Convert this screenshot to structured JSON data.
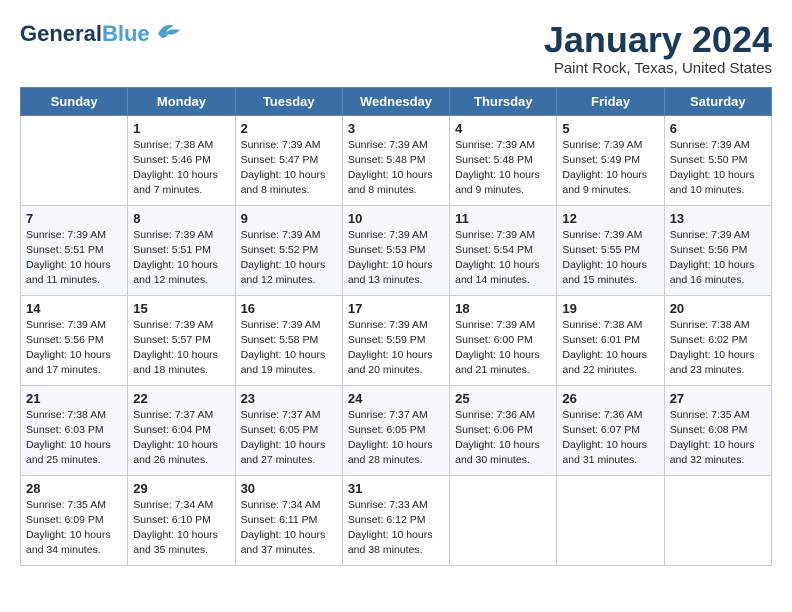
{
  "header": {
    "logo_general": "General",
    "logo_blue": "Blue",
    "title": "January 2024",
    "location": "Paint Rock, Texas, United States"
  },
  "days_of_week": [
    "Sunday",
    "Monday",
    "Tuesday",
    "Wednesday",
    "Thursday",
    "Friday",
    "Saturday"
  ],
  "weeks": [
    [
      {
        "day": "",
        "details": ""
      },
      {
        "day": "1",
        "details": "Sunrise: 7:38 AM\nSunset: 5:46 PM\nDaylight: 10 hours\nand 7 minutes."
      },
      {
        "day": "2",
        "details": "Sunrise: 7:39 AM\nSunset: 5:47 PM\nDaylight: 10 hours\nand 8 minutes."
      },
      {
        "day": "3",
        "details": "Sunrise: 7:39 AM\nSunset: 5:48 PM\nDaylight: 10 hours\nand 8 minutes."
      },
      {
        "day": "4",
        "details": "Sunrise: 7:39 AM\nSunset: 5:48 PM\nDaylight: 10 hours\nand 9 minutes."
      },
      {
        "day": "5",
        "details": "Sunrise: 7:39 AM\nSunset: 5:49 PM\nDaylight: 10 hours\nand 9 minutes."
      },
      {
        "day": "6",
        "details": "Sunrise: 7:39 AM\nSunset: 5:50 PM\nDaylight: 10 hours\nand 10 minutes."
      }
    ],
    [
      {
        "day": "7",
        "details": "Sunrise: 7:39 AM\nSunset: 5:51 PM\nDaylight: 10 hours\nand 11 minutes."
      },
      {
        "day": "8",
        "details": "Sunrise: 7:39 AM\nSunset: 5:51 PM\nDaylight: 10 hours\nand 12 minutes."
      },
      {
        "day": "9",
        "details": "Sunrise: 7:39 AM\nSunset: 5:52 PM\nDaylight: 10 hours\nand 12 minutes."
      },
      {
        "day": "10",
        "details": "Sunrise: 7:39 AM\nSunset: 5:53 PM\nDaylight: 10 hours\nand 13 minutes."
      },
      {
        "day": "11",
        "details": "Sunrise: 7:39 AM\nSunset: 5:54 PM\nDaylight: 10 hours\nand 14 minutes."
      },
      {
        "day": "12",
        "details": "Sunrise: 7:39 AM\nSunset: 5:55 PM\nDaylight: 10 hours\nand 15 minutes."
      },
      {
        "day": "13",
        "details": "Sunrise: 7:39 AM\nSunset: 5:56 PM\nDaylight: 10 hours\nand 16 minutes."
      }
    ],
    [
      {
        "day": "14",
        "details": "Sunrise: 7:39 AM\nSunset: 5:56 PM\nDaylight: 10 hours\nand 17 minutes."
      },
      {
        "day": "15",
        "details": "Sunrise: 7:39 AM\nSunset: 5:57 PM\nDaylight: 10 hours\nand 18 minutes."
      },
      {
        "day": "16",
        "details": "Sunrise: 7:39 AM\nSunset: 5:58 PM\nDaylight: 10 hours\nand 19 minutes."
      },
      {
        "day": "17",
        "details": "Sunrise: 7:39 AM\nSunset: 5:59 PM\nDaylight: 10 hours\nand 20 minutes."
      },
      {
        "day": "18",
        "details": "Sunrise: 7:39 AM\nSunset: 6:00 PM\nDaylight: 10 hours\nand 21 minutes."
      },
      {
        "day": "19",
        "details": "Sunrise: 7:38 AM\nSunset: 6:01 PM\nDaylight: 10 hours\nand 22 minutes."
      },
      {
        "day": "20",
        "details": "Sunrise: 7:38 AM\nSunset: 6:02 PM\nDaylight: 10 hours\nand 23 minutes."
      }
    ],
    [
      {
        "day": "21",
        "details": "Sunrise: 7:38 AM\nSunset: 6:03 PM\nDaylight: 10 hours\nand 25 minutes."
      },
      {
        "day": "22",
        "details": "Sunrise: 7:37 AM\nSunset: 6:04 PM\nDaylight: 10 hours\nand 26 minutes."
      },
      {
        "day": "23",
        "details": "Sunrise: 7:37 AM\nSunset: 6:05 PM\nDaylight: 10 hours\nand 27 minutes."
      },
      {
        "day": "24",
        "details": "Sunrise: 7:37 AM\nSunset: 6:05 PM\nDaylight: 10 hours\nand 28 minutes."
      },
      {
        "day": "25",
        "details": "Sunrise: 7:36 AM\nSunset: 6:06 PM\nDaylight: 10 hours\nand 30 minutes."
      },
      {
        "day": "26",
        "details": "Sunrise: 7:36 AM\nSunset: 6:07 PM\nDaylight: 10 hours\nand 31 minutes."
      },
      {
        "day": "27",
        "details": "Sunrise: 7:35 AM\nSunset: 6:08 PM\nDaylight: 10 hours\nand 32 minutes."
      }
    ],
    [
      {
        "day": "28",
        "details": "Sunrise: 7:35 AM\nSunset: 6:09 PM\nDaylight: 10 hours\nand 34 minutes."
      },
      {
        "day": "29",
        "details": "Sunrise: 7:34 AM\nSunset: 6:10 PM\nDaylight: 10 hours\nand 35 minutes."
      },
      {
        "day": "30",
        "details": "Sunrise: 7:34 AM\nSunset: 6:11 PM\nDaylight: 10 hours\nand 37 minutes."
      },
      {
        "day": "31",
        "details": "Sunrise: 7:33 AM\nSunset: 6:12 PM\nDaylight: 10 hours\nand 38 minutes."
      },
      {
        "day": "",
        "details": ""
      },
      {
        "day": "",
        "details": ""
      },
      {
        "day": "",
        "details": ""
      }
    ]
  ]
}
